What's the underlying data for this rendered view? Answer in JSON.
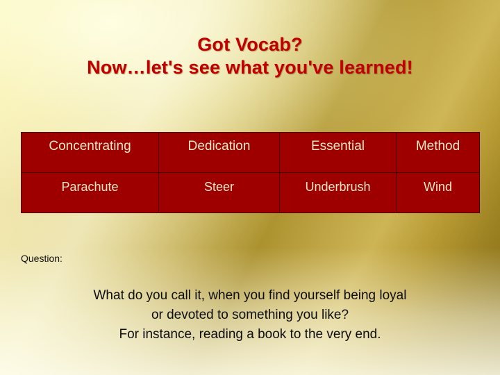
{
  "slide": {
    "title_line1": "Got Vocab?",
    "title_line2": "Now…let's see what you've learned!",
    "title_color": "#c00000",
    "table": {
      "cell_bg": "#9e0000",
      "cell_text_color": "#f3e9c8",
      "rows": [
        [
          "Concentrating",
          "Dedication",
          "Essential",
          "Method"
        ],
        [
          "Parachute",
          "Steer",
          "Underbrush",
          "Wind"
        ]
      ]
    },
    "question_label": "Question:",
    "question_lines": [
      "What do you call it, when you find yourself being loyal",
      "or devoted to something you like?",
      "For instance, reading a book to the very end."
    ]
  }
}
